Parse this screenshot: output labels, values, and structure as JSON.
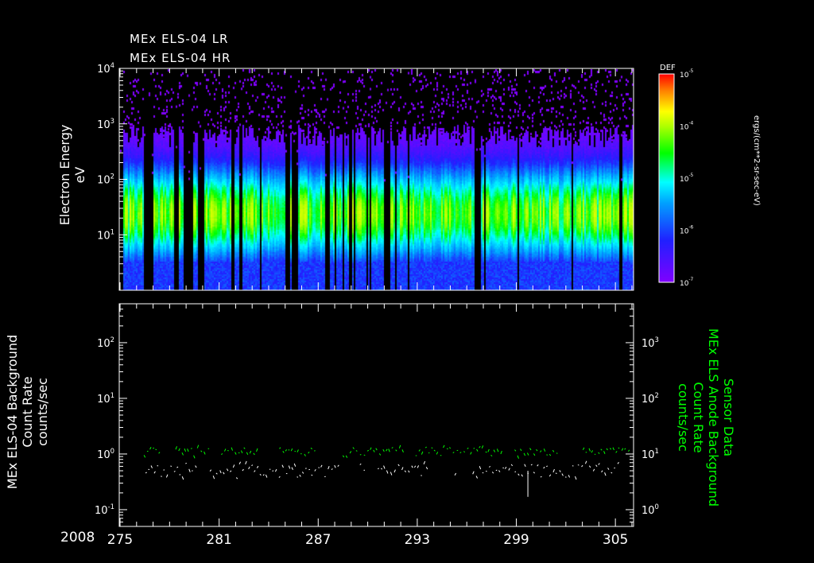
{
  "chart_data": [
    {
      "type": "heatmap",
      "titles": [
        "MEx ELS-04 LR",
        "MEx ELS-04 HR"
      ],
      "ylabel": "Electron Energy",
      "yunits": "eV",
      "yscale": "log",
      "ylim": [
        1,
        10000
      ],
      "yticks": [
        {
          "v": 10000,
          "b": "10",
          "e": "4"
        },
        {
          "v": 1000,
          "b": "10",
          "e": "3"
        },
        {
          "v": 100,
          "b": "10",
          "e": "2"
        },
        {
          "v": 10,
          "b": "10",
          "e": "1"
        }
      ],
      "xlim": [
        274.95,
        306.1
      ],
      "colorbar": {
        "label": "DEF",
        "units": "ergs/(cm**2-sr-sec-eV)",
        "range": [
          1e-07,
          1e-05
        ],
        "ticks": [
          {
            "b": "10",
            "e": "-5"
          },
          {
            "b": "10",
            "e": "-4"
          },
          {
            "b": "10",
            "e": "-5"
          },
          {
            "b": "10",
            "e": "-6"
          },
          {
            "b": "10",
            "e": "-7"
          }
        ]
      },
      "description_peak_energy_eV": [
        10,
        100
      ]
    },
    {
      "type": "line",
      "ylabel_left": [
        "MEx ELS-04 Background",
        "Count Rate",
        "counts/sec"
      ],
      "ylabel_right": [
        "Sensor Data",
        "MEx ELS Anode Background",
        "Count Rate",
        "counts/sec"
      ],
      "yscale": "log",
      "ylim_left": [
        0.05,
        500
      ],
      "ylim_right": [
        0.5,
        5000
      ],
      "yticks_left": [
        {
          "b": "10",
          "e": "2"
        },
        {
          "b": "10",
          "e": "1"
        },
        {
          "b": "10",
          "e": "0"
        },
        {
          "b": "10",
          "e": "-1"
        }
      ],
      "yticks_right": [
        {
          "b": "10",
          "e": "3"
        },
        {
          "b": "10",
          "e": "2"
        },
        {
          "b": "10",
          "e": "1"
        },
        {
          "b": "10",
          "e": "0"
        }
      ],
      "series": [
        {
          "name": "Sensor Data (right axis)",
          "color": "#00ff00",
          "typical": 11,
          "axis": "right"
        },
        {
          "name": "Background (left axis)",
          "color": "#ffffff",
          "typical": 0.5,
          "axis": "left",
          "min_spike": {
            "x": 299.7,
            "y": 0.17
          }
        }
      ]
    }
  ],
  "xaxis": {
    "year": "2008",
    "ticks": [
      "275",
      "281",
      "287",
      "293",
      "299",
      "305"
    ],
    "tick_values": [
      275,
      281,
      287,
      293,
      299,
      305
    ]
  }
}
